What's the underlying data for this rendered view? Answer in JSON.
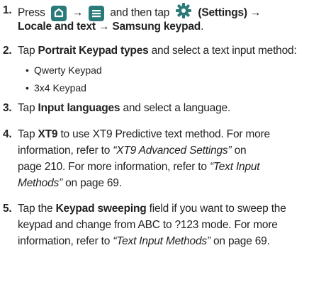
{
  "steps": [
    {
      "num": "1.",
      "press": "Press",
      "arrow1": "→",
      "then_tap": "and then tap",
      "settings_label": "(Settings)",
      "arrow2": "→",
      "locale": "Locale and text",
      "arrow3": "→",
      "keypad": "Samsung keypad",
      "period": "."
    },
    {
      "num": "2.",
      "tap": "Tap",
      "target": "Portrait Keypad types",
      "rest": "and select a text input method:",
      "options": [
        "Qwerty Keypad",
        "3x4 Keypad"
      ]
    },
    {
      "num": "3.",
      "tap": "Tap",
      "target": "Input languages",
      "rest": "and select a language."
    },
    {
      "num": "4.",
      "tap": "Tap",
      "target": "XT9",
      "line1_rest": "to use XT9 Predictive text method. For more",
      "line2_pre": "information, refer to",
      "ref1": "“XT9 Advanced Settings”",
      "line2_post": "on",
      "line3_pre": "page 210. For more information, refer to",
      "ref2_a": "“Text Input",
      "ref2_b": "Methods”",
      "line4_post": "on page 69."
    },
    {
      "num": "5.",
      "tap": "Tap the",
      "target": "Keypad sweeping",
      "line1_rest": "field if you want to sweep the",
      "line2": "keypad and change from ABC to ?123 mode. For more",
      "line3_pre": "information, refer to",
      "ref": "“Text Input Methods”",
      "line3_post": "on page 69."
    }
  ],
  "bullet": "•",
  "colors": {
    "icon": "#2a7a7a",
    "text": "#222222"
  },
  "icons": [
    "home-key-icon",
    "menu-key-icon",
    "settings-gear-icon"
  ]
}
